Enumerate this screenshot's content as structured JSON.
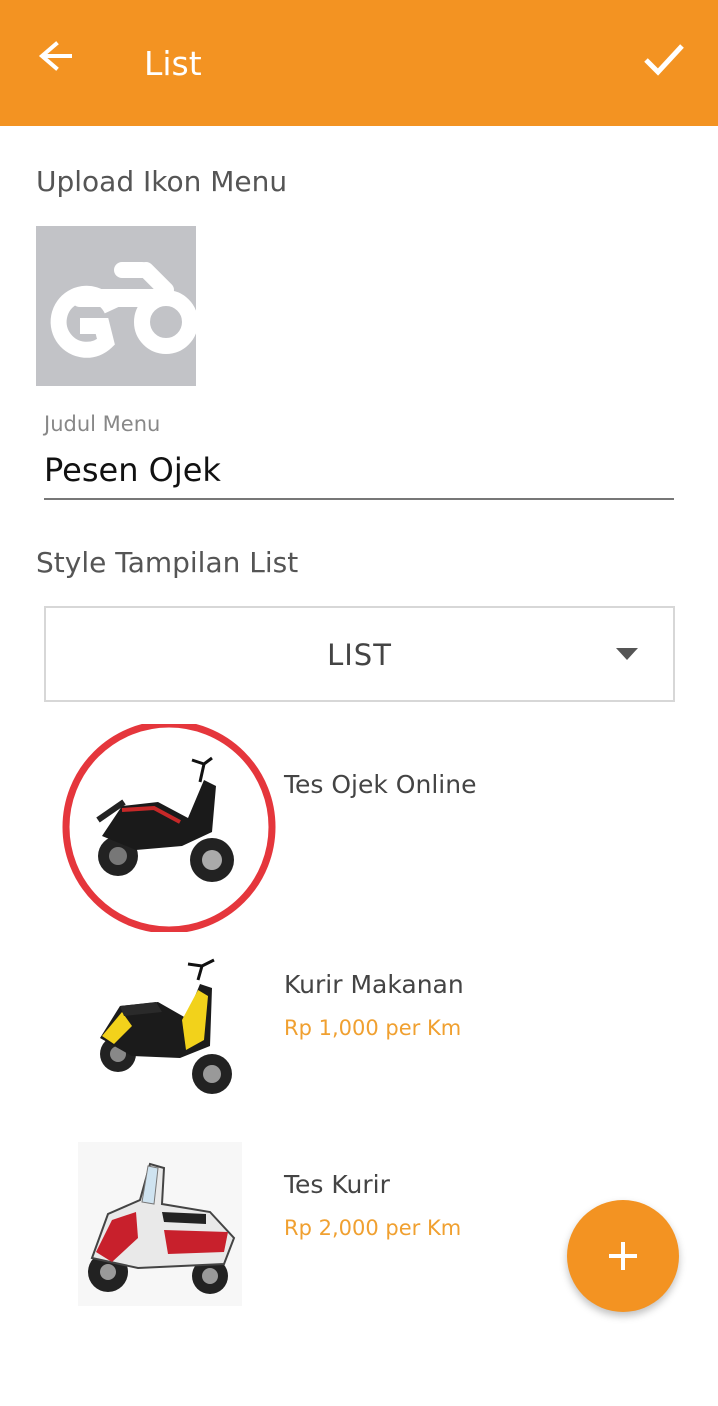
{
  "appbar": {
    "title": "List",
    "back_icon": "arrow-left-icon",
    "confirm_icon": "check-icon",
    "color": "#f39322"
  },
  "form": {
    "upload_label": "Upload Ikon Menu",
    "icon_image": "motorbike-go-icon",
    "title_field_label": "Judul Menu",
    "title_field_value": "Pesen Ojek",
    "style_label": "Style Tampilan List",
    "style_selected": "LIST"
  },
  "items": [
    {
      "title": "Tes Ojek Online",
      "price": "",
      "image": "scooter-black-red",
      "selected": true
    },
    {
      "title": "Kurir Makanan",
      "price": "Rp 1,000 per Km",
      "image": "scooter-yellow-black",
      "selected": false
    },
    {
      "title": "Tes Kurir",
      "price": "Rp 2,000 per Km",
      "image": "scooter-red-white",
      "selected": false
    }
  ],
  "fab": {
    "icon": "plus-icon"
  },
  "colors": {
    "accent": "#f39322",
    "price": "#f0a030",
    "selection_ring": "#e5363c"
  }
}
